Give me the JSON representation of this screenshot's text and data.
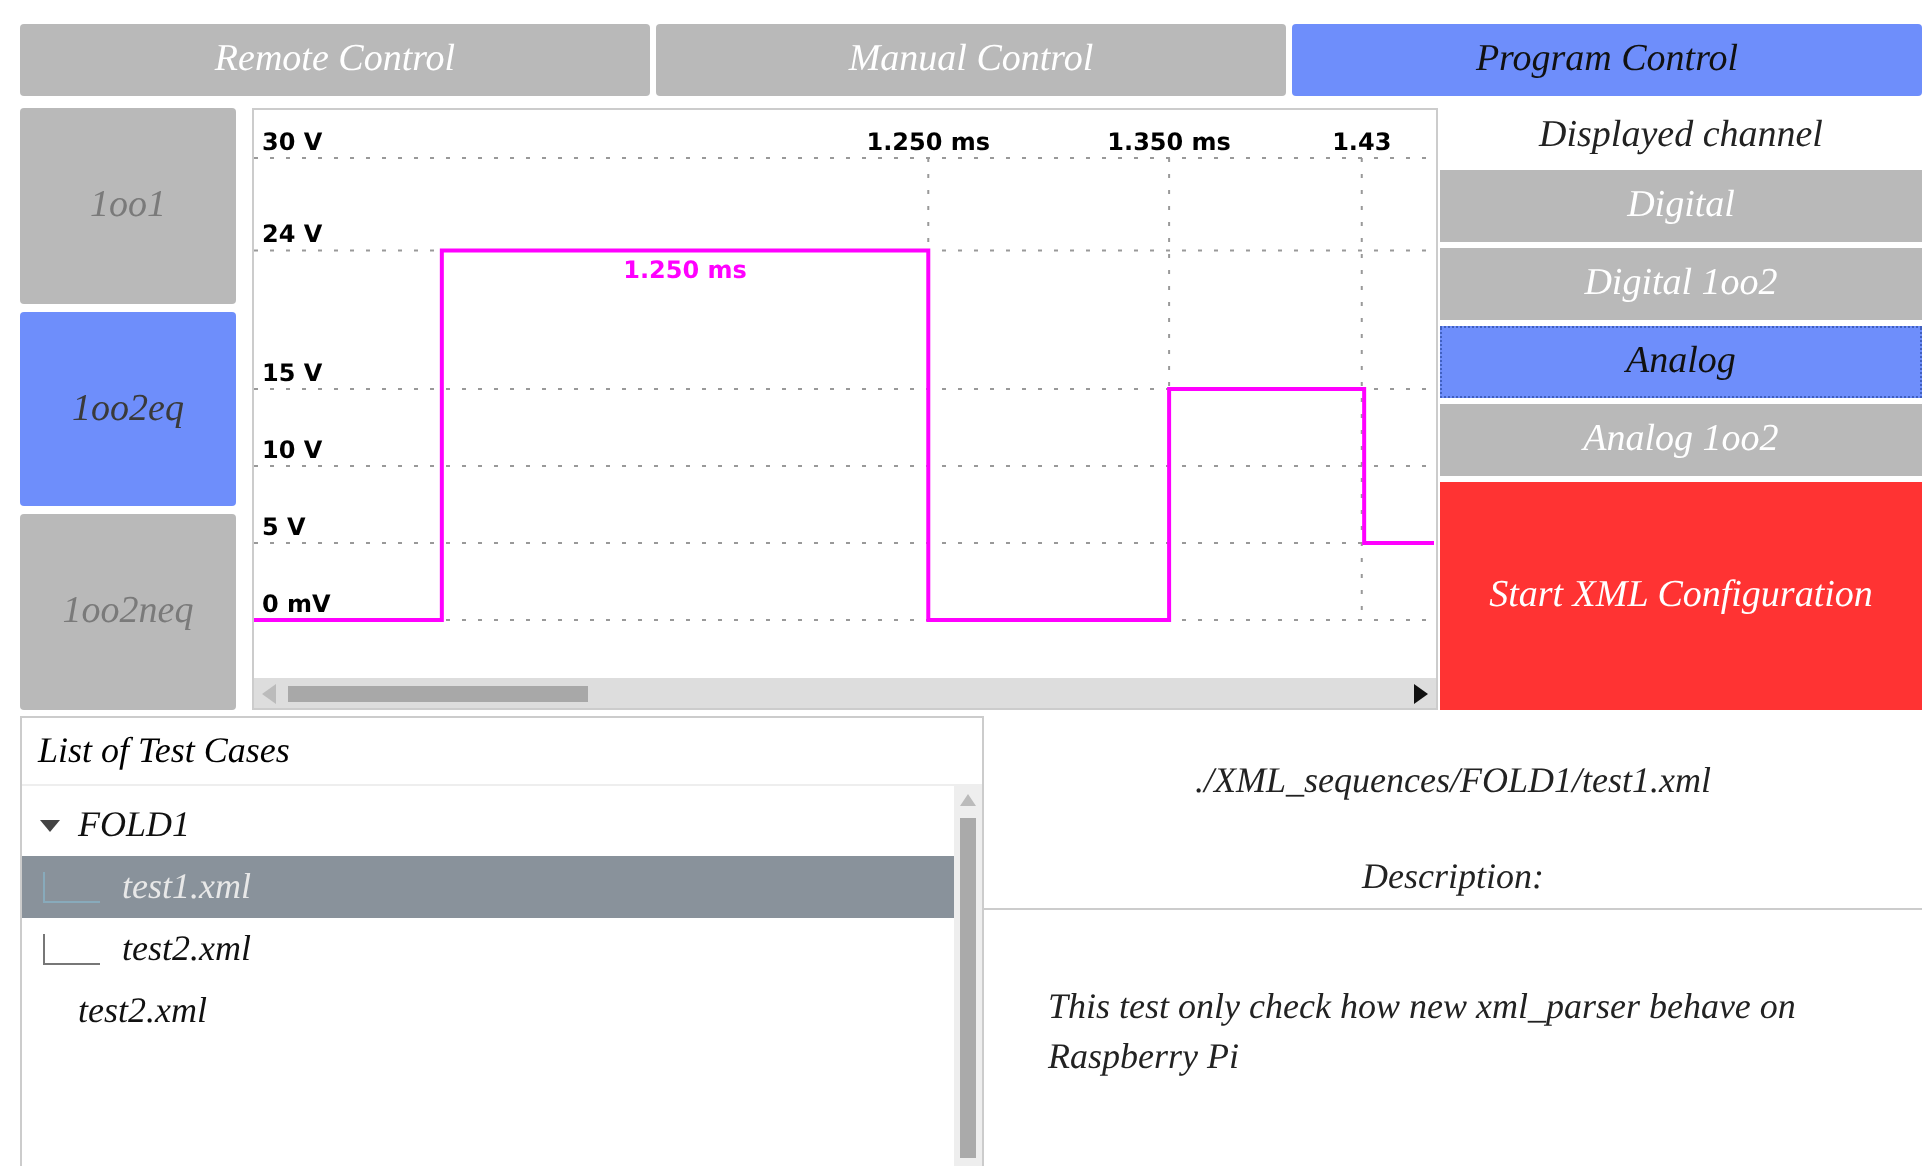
{
  "tabs": [
    {
      "label": "Remote Control",
      "selected": false
    },
    {
      "label": "Manual Control",
      "selected": false
    },
    {
      "label": "Program Control",
      "selected": true
    }
  ],
  "modes": [
    {
      "label": "1oo1",
      "selected": false
    },
    {
      "label": "1oo2eq",
      "selected": true
    },
    {
      "label": "1oo2neq",
      "selected": false
    }
  ],
  "chart": {
    "chart_data": {
      "type": "line",
      "grid": true,
      "xlim": [
        0.97,
        1.46
      ],
      "ylim": [
        0,
        30
      ],
      "yticks": [
        {
          "value": 30,
          "label": "30 V"
        },
        {
          "value": 24,
          "label": "24 V"
        },
        {
          "value": 15,
          "label": "15 V"
        },
        {
          "value": 10,
          "label": "10 V"
        },
        {
          "value": 5,
          "label": "5 V"
        },
        {
          "value": 0,
          "label": "0 mV"
        }
      ],
      "xticks": [
        {
          "value": 1.25,
          "label": "1.250 ms"
        },
        {
          "value": 1.35,
          "label": "1.350 ms"
        },
        {
          "value": 1.43,
          "label": "1.43"
        }
      ],
      "series": [
        {
          "color": "#ff00ff",
          "values": [
            0,
            0,
            24,
            24,
            0,
            0,
            15,
            15,
            5,
            5
          ]
        }
      ],
      "x": [
        0.97,
        1.048,
        1.048,
        1.25,
        1.25,
        1.35,
        1.35,
        1.431,
        1.431,
        1.46
      ],
      "annotations": [
        "1.250 ms"
      ]
    }
  },
  "channel_panel": {
    "title": "Displayed channel",
    "channels": [
      {
        "label": "Digital",
        "selected": false
      },
      {
        "label": "Digital 1oo2",
        "selected": false
      },
      {
        "label": "Analog",
        "selected": true
      },
      {
        "label": "Analog 1oo2",
        "selected": false
      }
    ],
    "start_button": "Start XML Configuration"
  },
  "test_cases": {
    "title": "List of Test Cases",
    "tree": [
      {
        "label": "FOLD1",
        "expanded": true,
        "selected": false,
        "children": [
          {
            "label": "test1.xml",
            "selected": true
          },
          {
            "label": "test2.xml",
            "selected": false
          }
        ]
      },
      {
        "label": "test2.xml",
        "selected": false
      }
    ]
  },
  "details": {
    "path": "./XML_sequences/FOLD1/test1.xml",
    "description_label": "Description:",
    "description": "This test only check how new xml_parser behave on Raspberry Pi"
  }
}
